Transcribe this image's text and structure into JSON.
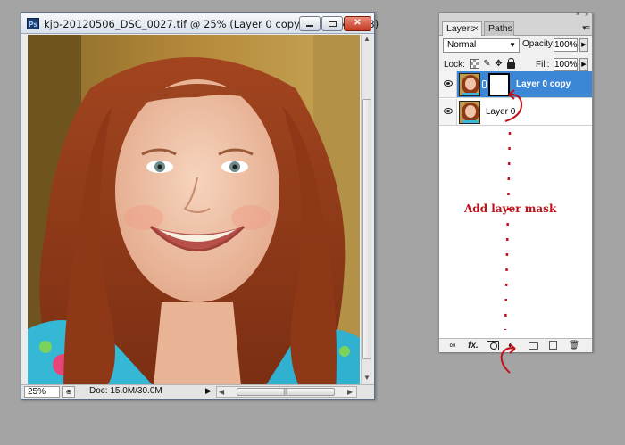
{
  "document_window": {
    "title": "kjb-20120506_DSC_0027.tif @ 25% (Layer 0 copy, Layer Mask/8)",
    "app_icon": "Ps",
    "close_glyph": "✕",
    "zoom": "25%",
    "doc_info": "Doc: 15.0M/30.0M",
    "colors": {
      "titlebar": "#dde6f0",
      "close": "#c23a22"
    }
  },
  "layers_panel": {
    "tabs": [
      {
        "label": "Layers",
        "active": true,
        "close_glyph": "×"
      },
      {
        "label": "Paths",
        "active": false
      }
    ],
    "blend_mode": "Normal",
    "opacity_label": "Opacity:",
    "opacity_value": "100%",
    "lock_label": "Lock:",
    "fill_label": "Fill:",
    "fill_value": "100%",
    "layers": [
      {
        "name": "Layer 0 copy",
        "selected": true,
        "has_mask": true,
        "visible": true
      },
      {
        "name": "Layer 0",
        "selected": false,
        "has_mask": false,
        "visible": true
      }
    ],
    "bottom_icons": [
      "link-icon",
      "fx-icon",
      "add-layer-mask-icon",
      "adjustment-layer-icon",
      "new-group-icon",
      "new-layer-icon",
      "trash-icon"
    ],
    "fx_label": "fx.",
    "colors": {
      "selected_row": "#3c86d6"
    }
  },
  "annotation": {
    "text": "Add layer mask",
    "color": "#c0101a"
  }
}
